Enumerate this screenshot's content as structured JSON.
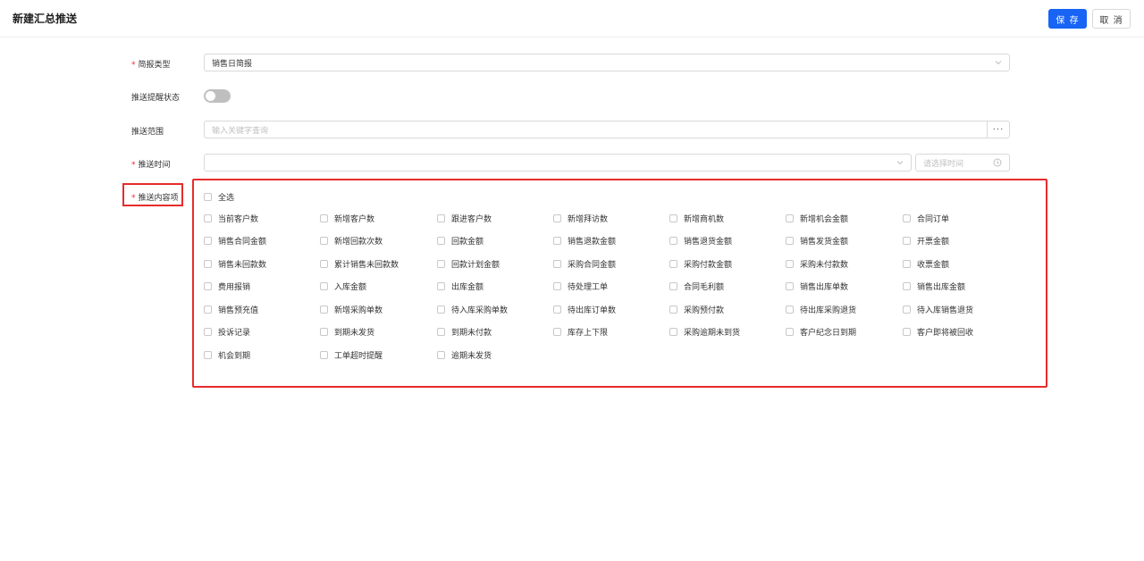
{
  "header": {
    "title": "新建汇总推送",
    "save_label": "保 存",
    "cancel_label": "取 消"
  },
  "form": {
    "required_mark": "*",
    "report_type": {
      "label": "简报类型",
      "value": "销售日简报"
    },
    "remind_status": {
      "label": "推送提醒状态",
      "enabled": false
    },
    "scope": {
      "label": "推送范围",
      "placeholder": "输入关键字查询",
      "more_label": "···"
    },
    "push_time": {
      "label": "推送时间",
      "value": "",
      "time_placeholder": "请选择时间"
    },
    "content": {
      "label": "推送内容项",
      "select_all": "全选",
      "items": [
        "当前客户数",
        "新增客户数",
        "跟进客户数",
        "新增拜访数",
        "新增商机数",
        "新增机会金额",
        "合同订单",
        "销售合同金额",
        "新增回款次数",
        "回款金额",
        "销售退款金额",
        "销售退货金额",
        "销售发货金额",
        "开票金额",
        "销售未回款数",
        "累计销售未回款数",
        "回款计划金额",
        "采购合同金额",
        "采购付款金额",
        "采购未付款数",
        "收票金额",
        "费用报销",
        "入库金额",
        "出库金额",
        "待处理工单",
        "合同毛利额",
        "销售出库单数",
        "销售出库金额",
        "销售预充值",
        "新增采购单数",
        "待入库采购单数",
        "待出库订单数",
        "采购预付款",
        "待出库采购退货",
        "待入库销售退货",
        "投诉记录",
        "到期未发货",
        "到期未付款",
        "库存上下限",
        "采购逾期未到货",
        "客户纪念日到期",
        "客户即将被回收",
        "机会到期",
        "工单超时提醒",
        "逾期未发货"
      ]
    }
  },
  "colors": {
    "primary": "#1764f5",
    "required": "#f5222d",
    "highlight": "#e62c2c"
  }
}
